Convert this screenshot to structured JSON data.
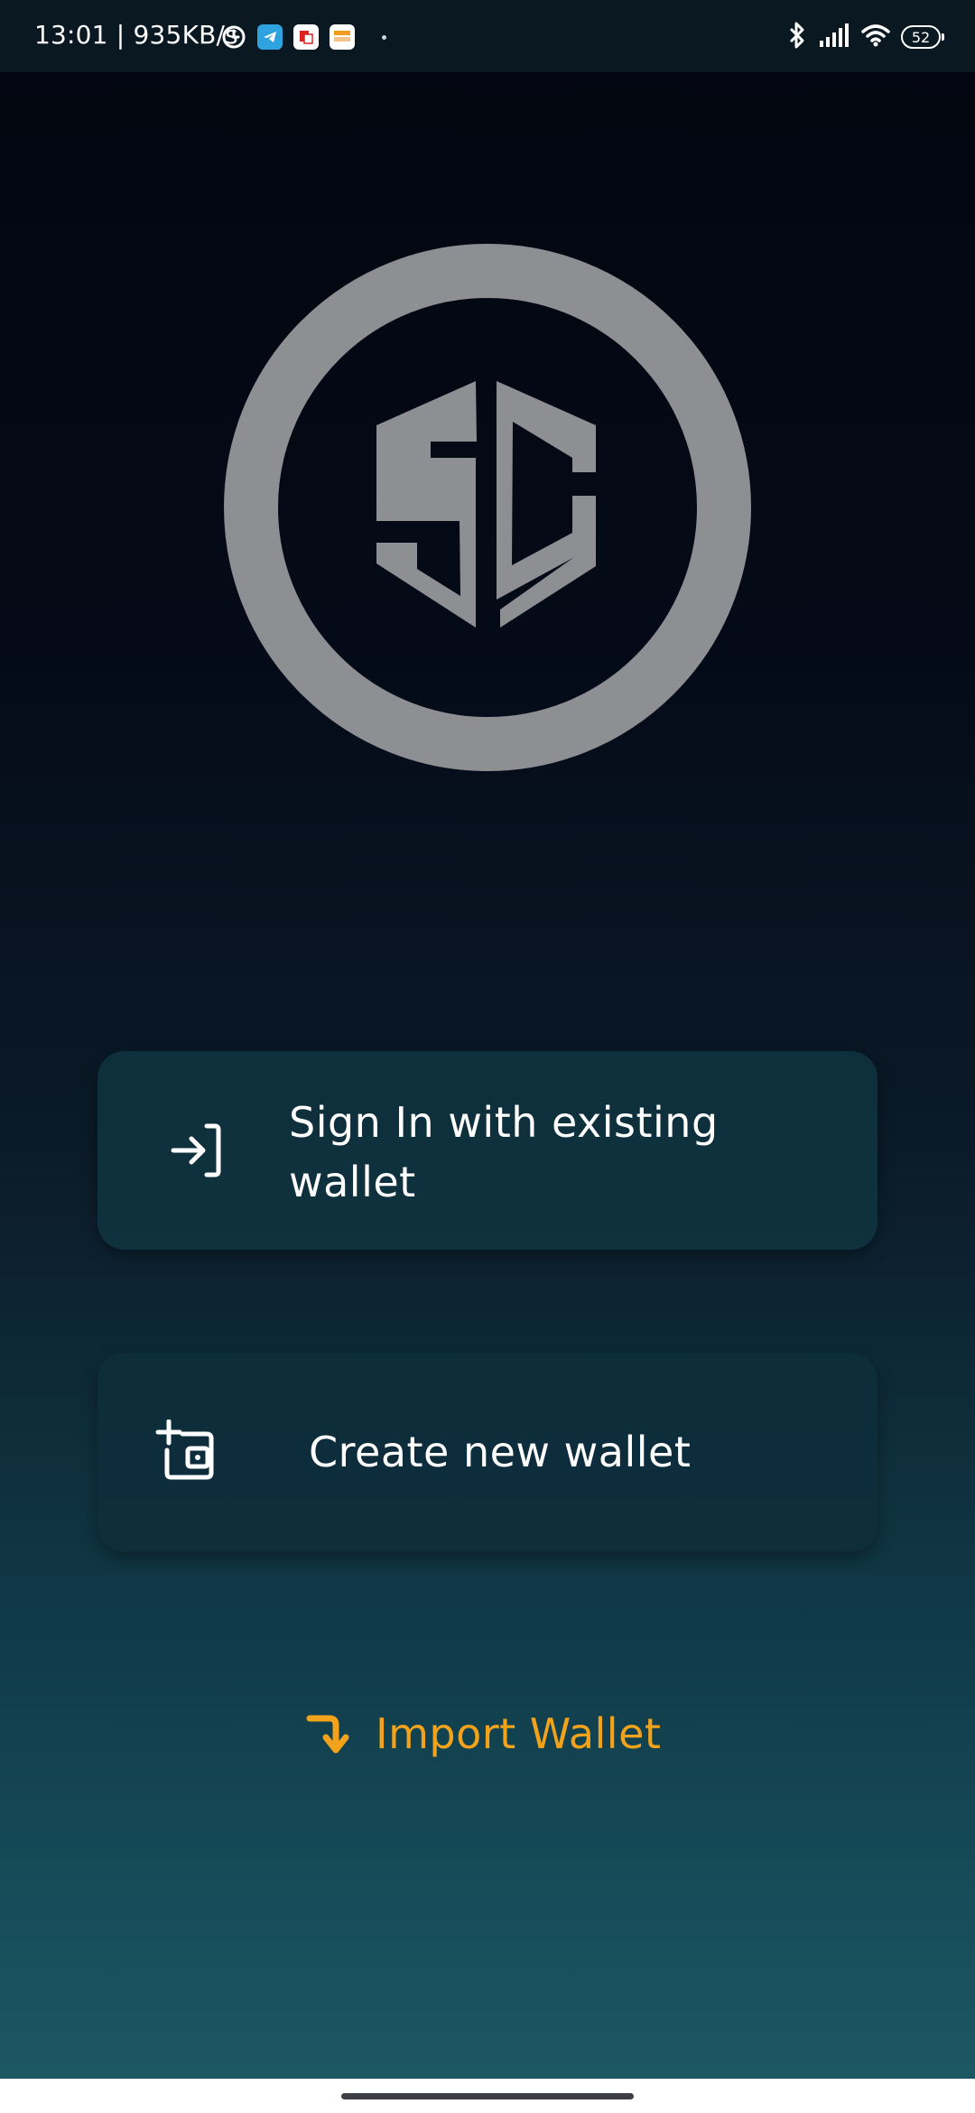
{
  "status_bar": {
    "time": "13:01 | 935KB/s",
    "battery": "52",
    "icons": [
      "alarm-icon",
      "telegram-icon",
      "news-app-icon",
      "shopping-app-icon",
      "bluetooth-icon",
      "signal-icon",
      "wifi-icon",
      "battery-icon"
    ]
  },
  "logo": {
    "icon": "sc-logo",
    "ring_color": "#8e8f93"
  },
  "actions": {
    "sign_in": {
      "label": "Sign In with existing wallet",
      "icon": "login-arrow-icon"
    },
    "create": {
      "label": "Create new wallet",
      "icon": "add-wallet-icon"
    },
    "import": {
      "label": "Import Wallet",
      "icon": "arrow-down-curve-icon",
      "color": "#f2a31b"
    }
  },
  "colors": {
    "card_bg": "#103642",
    "accent": "#f2a31b",
    "background_top": "#03060f",
    "background_bottom": "#1d5a66"
  }
}
